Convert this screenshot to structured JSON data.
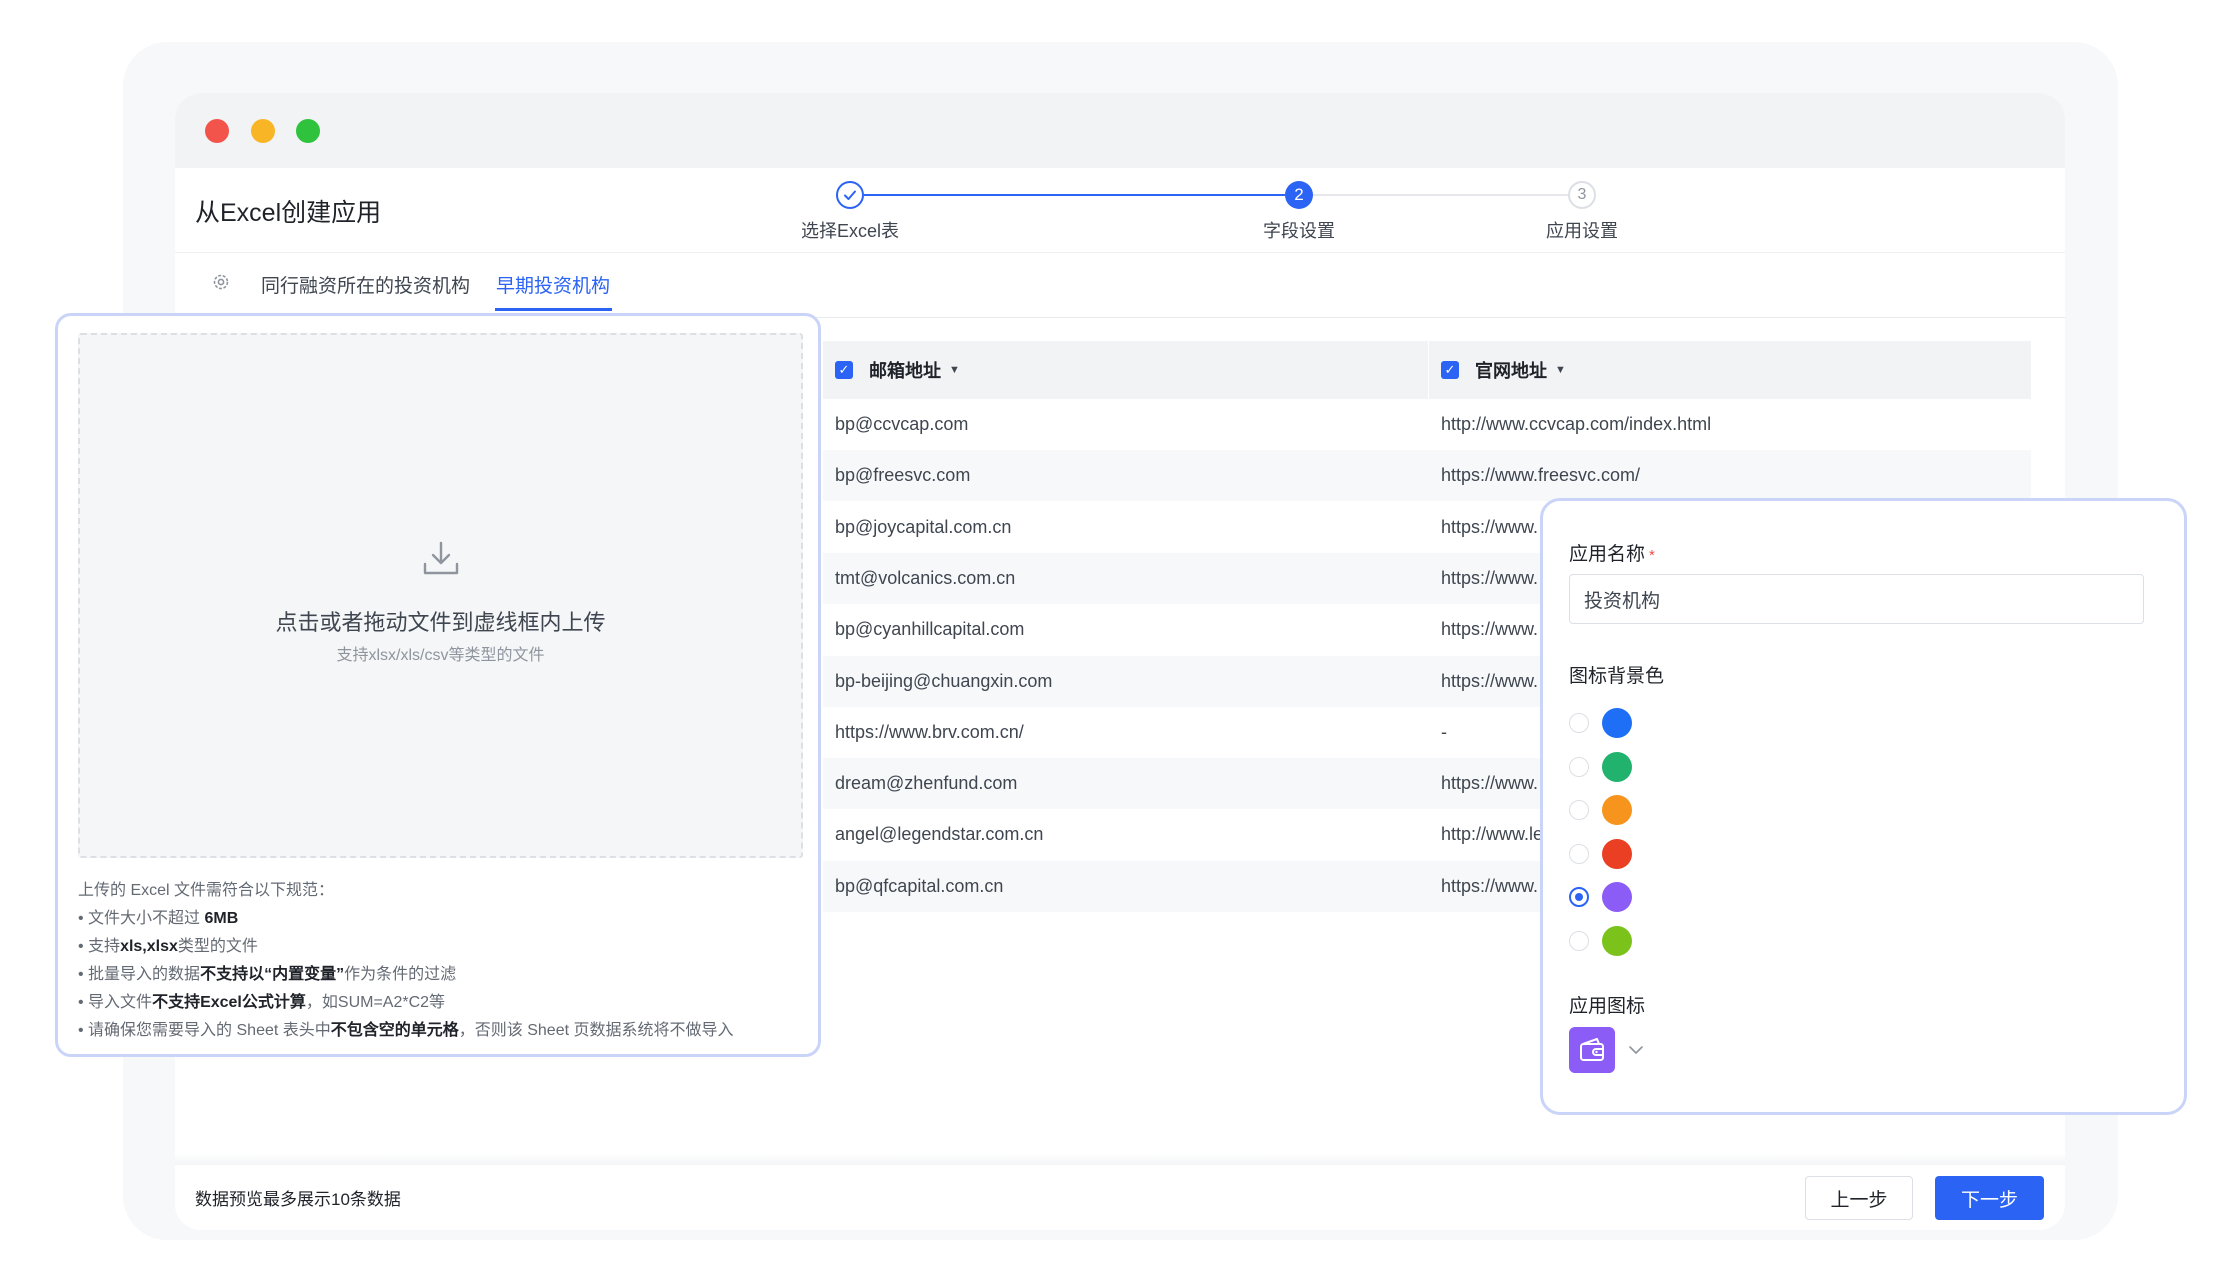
{
  "app": {
    "title": "从Excel创建应用"
  },
  "stepper": {
    "steps": [
      {
        "number": "",
        "label": "选择Excel表",
        "state": "done"
      },
      {
        "number": "2",
        "label": "字段设置",
        "state": "active"
      },
      {
        "number": "3",
        "label": "应用设置",
        "state": "pending"
      }
    ]
  },
  "tabs": [
    {
      "label": "同行融资所在的投资机构",
      "active": false
    },
    {
      "label": "早期投资机构",
      "active": true
    }
  ],
  "table": {
    "columns": [
      "邮箱地址",
      "官网地址"
    ],
    "rows": [
      [
        "bp@ccvcap.com",
        "http://www.ccvcap.com/index.html"
      ],
      [
        "bp@freesvc.com",
        "https://www.freesvc.com/"
      ],
      [
        "bp@joycapital.com.cn",
        "https://www."
      ],
      [
        "tmt@volcanics.com.cn",
        "https://www."
      ],
      [
        "bp@cyanhillcapital.com",
        "https://www."
      ],
      [
        "bp-beijing@chuangxin.com",
        "https://www."
      ],
      [
        "https://www.brv.com.cn/",
        "-"
      ],
      [
        "dream@zhenfund.com",
        "https://www."
      ],
      [
        "angel@legendstar.com.cn",
        "http://www.le"
      ],
      [
        "bp@qfcapital.com.cn",
        "https://www."
      ]
    ]
  },
  "upload": {
    "title": "点击或者拖动文件到虚线框内上传",
    "subtitle": "支持xlsx/xls/csv等类型的文件",
    "rules_heading": "上传的 Excel 文件需符合以下规范：",
    "rules": [
      {
        "pre": "• 文件大小不超过 ",
        "bold": "6MB",
        "post": ""
      },
      {
        "pre": "• 支持",
        "bold": "xls,xlsx",
        "post": "类型的文件"
      },
      {
        "pre": "• 批量导入的数据",
        "bold": "不支持以“内置变量”",
        "post": "作为条件的过滤"
      },
      {
        "pre": "• 导入文件",
        "bold": "不支持Excel公式计算",
        "post": "，如SUM=A2*C2等"
      },
      {
        "pre": "• 请确保您需要导入的 Sheet 表头中",
        "bold": "不包含空的单元格",
        "post": "，否则该 Sheet 页数据系统将不做导入"
      }
    ]
  },
  "settings": {
    "name_label": "应用名称",
    "required_mark": "*",
    "name_value": "投资机构",
    "color_label": "图标背景色",
    "colors": [
      {
        "hex": "#1e6ff5",
        "selected": false
      },
      {
        "hex": "#21b36d",
        "selected": false
      },
      {
        "hex": "#f7941d",
        "selected": false
      },
      {
        "hex": "#ea3f23",
        "selected": false
      },
      {
        "hex": "#8b5cf6",
        "selected": true
      },
      {
        "hex": "#7bc21b",
        "selected": false
      }
    ],
    "icon_label": "应用图标",
    "icon_name": "wallet-icon"
  },
  "footer": {
    "note": "数据预览最多展示10条数据",
    "prev_label": "上一步",
    "next_label": "下一步"
  }
}
